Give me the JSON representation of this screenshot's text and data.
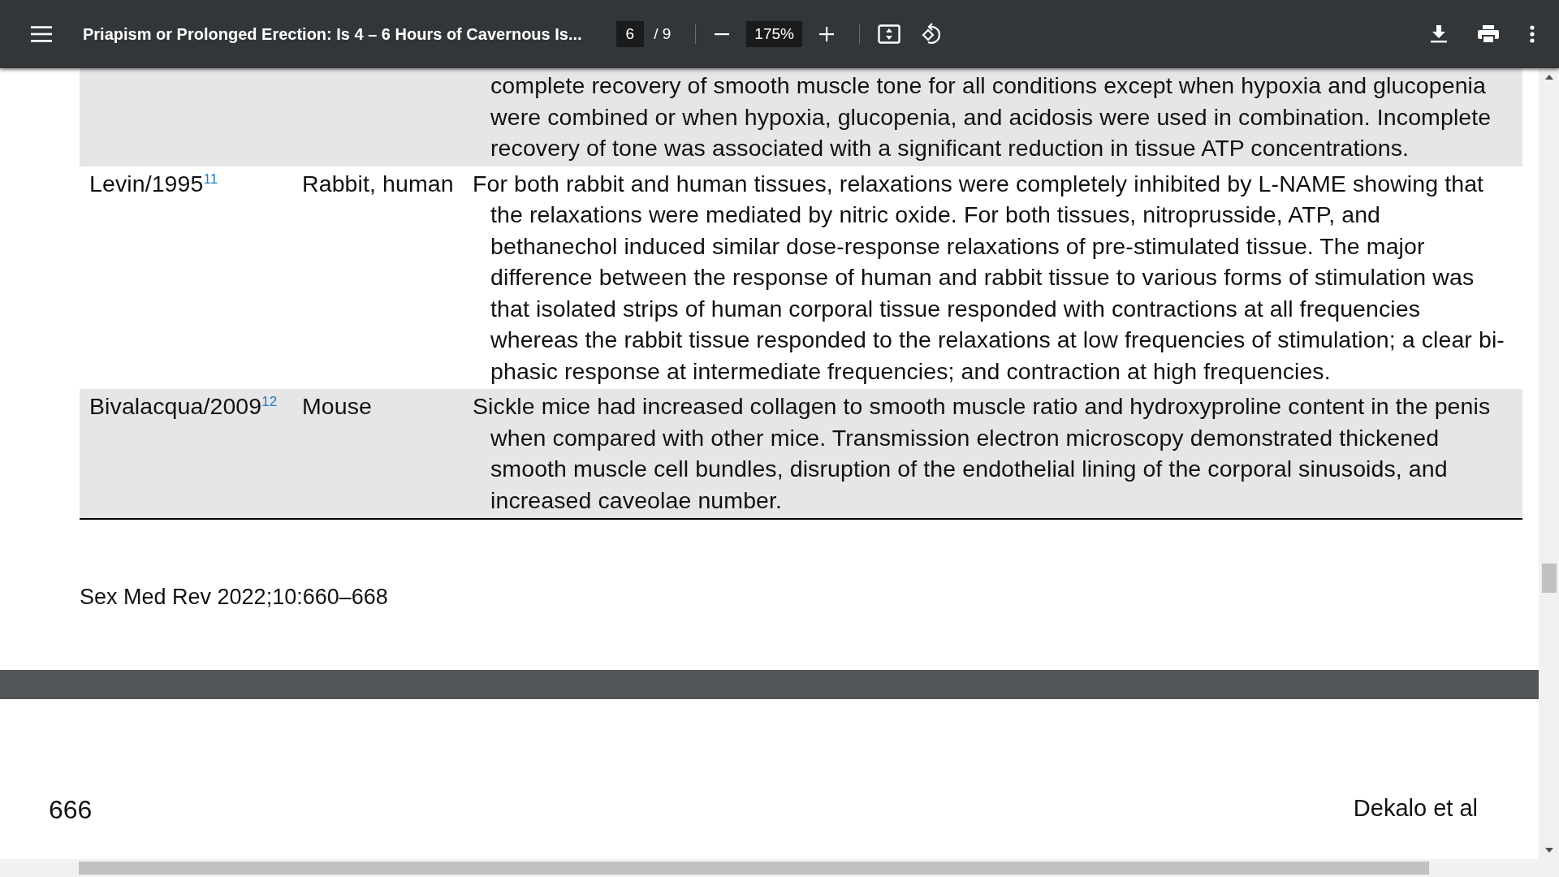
{
  "toolbar": {
    "title": "Priapism or Prolonged Erection: Is 4 – 6 Hours of Cavernous Is...",
    "page": "6",
    "page_count": "/ 9",
    "zoom": "175%"
  },
  "table": {
    "rows": [
      {
        "author": "",
        "species": "",
        "text": "complete recovery of smooth muscle tone for all conditions except when hypoxia and glucopenia were combined or when hypoxia, glucopenia, and acidosis were used in combination. Incomplete recovery of tone was associated with a significant reduction in tissue ATP concentrations.",
        "continued": true,
        "shaded": true
      },
      {
        "author": "Levin/1995$^{11}$",
        "species": "Rabbit, human",
        "text": "For both rabbit and human tissues, relaxations were completely inhibited by L-NAME showing that the relaxations were mediated by nitric oxide. For both tissues, nitroprusside, ATP, and bethanechol induced similar dose-response relaxations of pre-stimulated tissue. The major difference between the response of human and rabbit tissue to various forms of stimulation was that isolated strips of human corporal tissue responded with contractions at all frequencies whereas the rabbit tissue responded to the relaxations at low frequencies of stimulation; a clear bi-phasic response at intermediate frequencies; and contraction at high frequencies.",
        "continued": false,
        "shaded": false
      },
      {
        "author": "Bivalacqua/2009$^{12}$",
        "species": "Mouse",
        "text": "Sickle mice had increased collagen to smooth muscle ratio and hydroxyproline content in the penis when compared with other mice. Transmission electron microscopy demonstrated thickened smooth muscle cell bundles, disruption of the endothelial lining of the corporal sinusoids, and increased caveolae number.",
        "continued": false,
        "shaded": true
      }
    ]
  },
  "page_footer": "Sex Med Rev 2022;10:660–668",
  "next_page": {
    "page_number": "666",
    "running_head": "Dekalo et al"
  }
}
